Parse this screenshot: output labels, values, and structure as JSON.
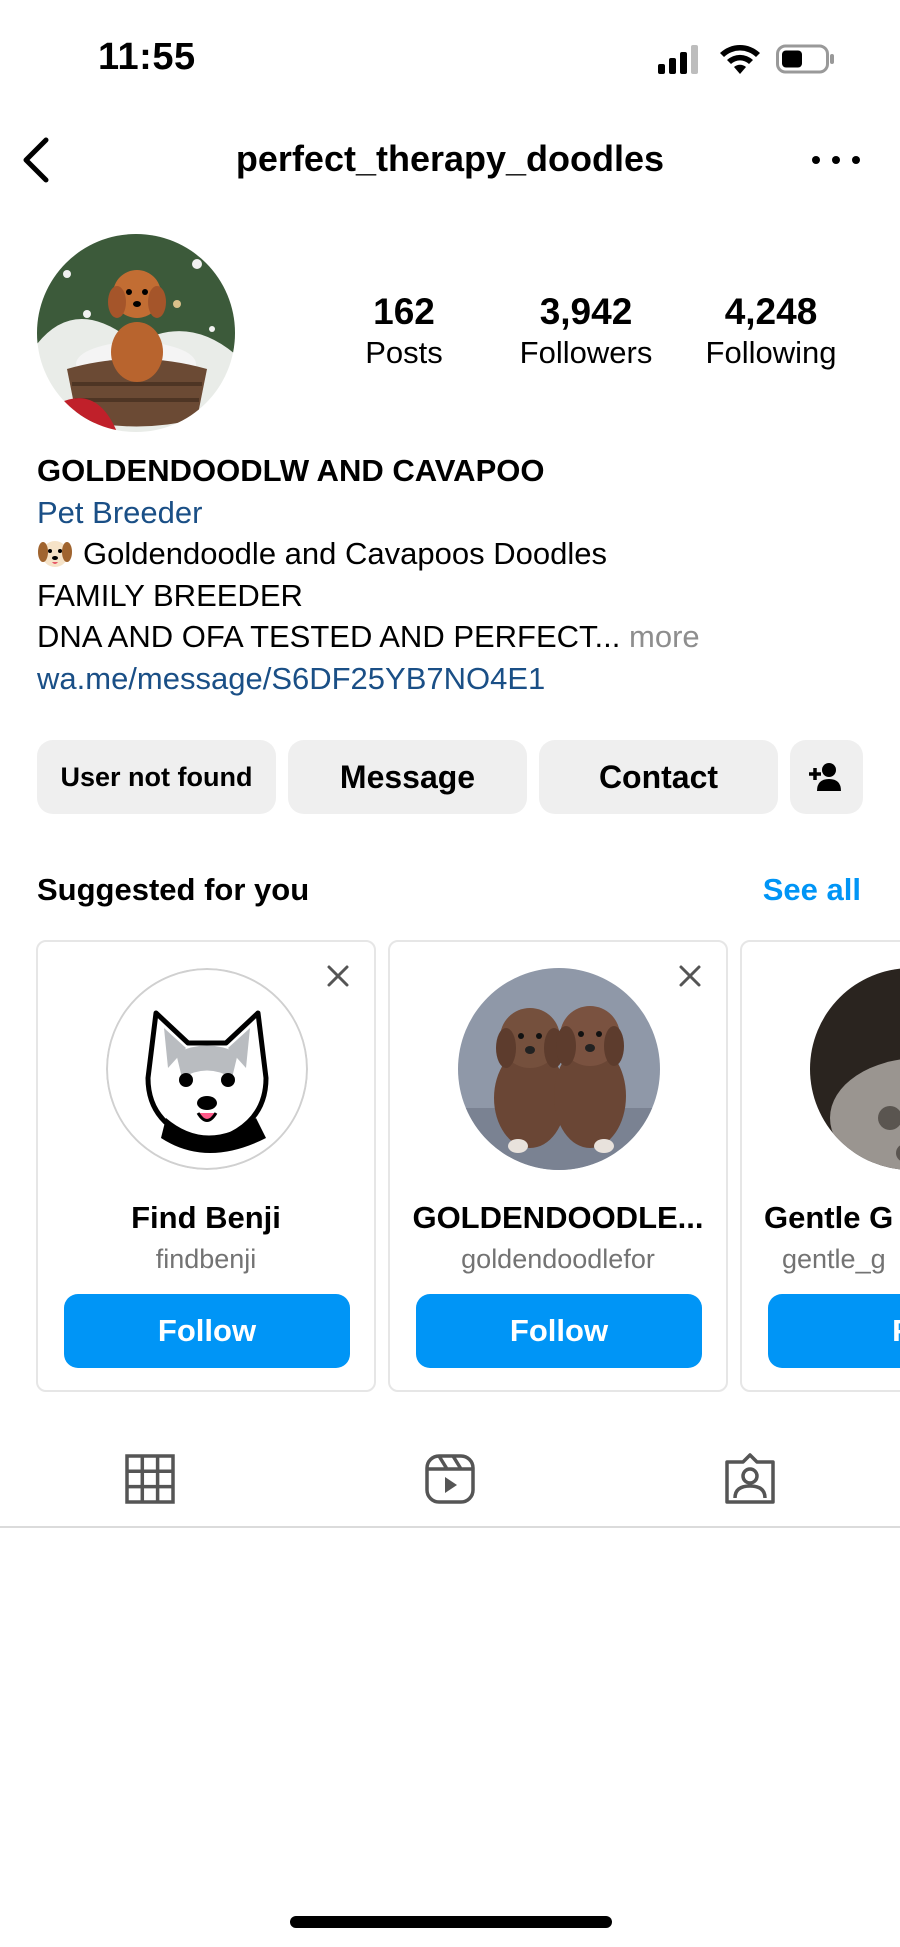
{
  "status_bar": {
    "time": "11:55"
  },
  "nav": {
    "title": "perfect_therapy_doodles"
  },
  "profile": {
    "stats": [
      {
        "value": "162",
        "label": "Posts"
      },
      {
        "value": "3,942",
        "label": "Followers"
      },
      {
        "value": "4,248",
        "label": "Following"
      }
    ],
    "name": "GOLDENDOODLW AND CAVAPOO",
    "category": "Pet Breeder",
    "bio_line1": "Goldendoodle and Cavapoos Doodles",
    "bio_line2": "FAMILY BREEDER",
    "bio_line3": "DNA AND OFA TESTED AND PERFECT...",
    "more_label": "more",
    "link": "wa.me/message/S6DF25YB7NO4E1"
  },
  "actions": {
    "user_not_found": "User not found",
    "message": "Message",
    "contact": "Contact"
  },
  "suggested": {
    "title": "Suggested for you",
    "see_all": "See all",
    "cards": [
      {
        "name": "Find Benji",
        "handle": "findbenji",
        "follow": "Follow"
      },
      {
        "name": "GOLDENDOODLE...",
        "handle": "goldendoodlefor",
        "follow": "Follow"
      },
      {
        "name": "Gentle G",
        "handle": "gentle_g",
        "follow": "Fo"
      }
    ]
  },
  "colors": {
    "accent": "#0095f6",
    "link": "#1a4f86",
    "button_bg": "#efefef"
  },
  "icons": {
    "back": "chevron-left-icon",
    "more": "more-horizontal-icon",
    "add_user": "person-plus-icon",
    "close": "close-icon",
    "grid": "grid-icon",
    "reels": "reels-icon",
    "tagged": "tagged-icon"
  }
}
